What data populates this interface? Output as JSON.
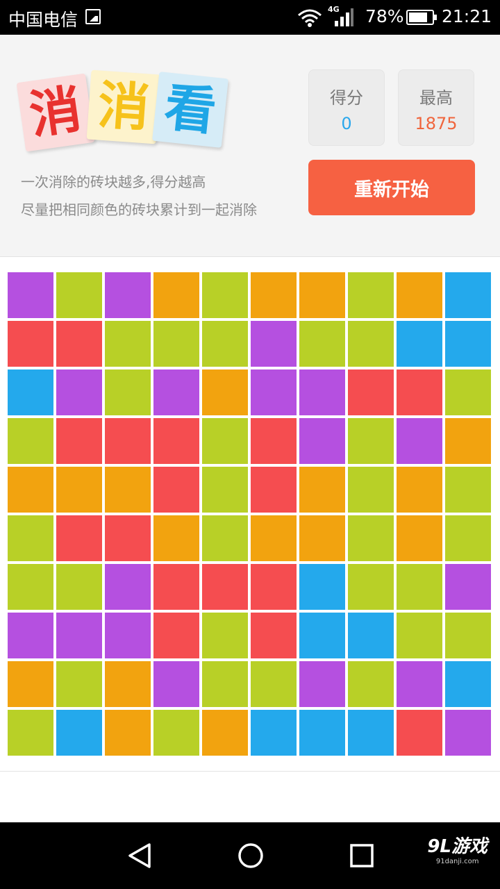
{
  "status_bar": {
    "carrier": "中国电信",
    "network": "4G",
    "battery": "78%",
    "time": "21:21"
  },
  "header": {
    "logo_chars": [
      "消",
      "消",
      "看"
    ],
    "hint_1": "一次消除的砖块越多,得分越高",
    "hint_2": "尽量把相同颜色的砖块累计到一起消除",
    "score_label": "得分",
    "score_value": "0",
    "best_label": "最高",
    "best_value": "1875",
    "restart_label": "重新开始"
  },
  "colors": {
    "P": "#b550e0",
    "G": "#b8d027",
    "O": "#f2a30f",
    "B": "#24a9ec",
    "R": "#f54d50"
  },
  "board": [
    "PGPOGOOGOB",
    "RRGGGPGGBB",
    "BPGPOPPRRG",
    "GRRRGRPGPO",
    "OOORGROGOG",
    "GRROGOOGOG",
    "GGPRRRBGGP",
    "PPPRGRBBGG",
    "OGOPGGPGPB",
    "GBOGOBBBRP"
  ],
  "nav": {
    "back_icon": "back-triangle-icon",
    "home_icon": "home-circle-icon",
    "recent_icon": "recent-square-icon"
  },
  "watermark": {
    "logo": "9L游戏",
    "url": "91danji.com"
  }
}
